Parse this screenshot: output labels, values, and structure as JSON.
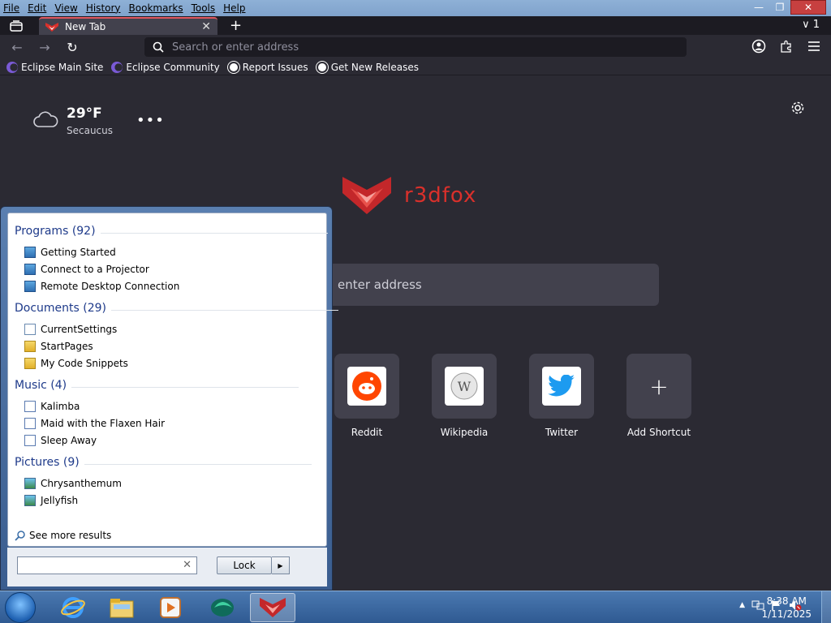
{
  "menu": [
    "File",
    "Edit",
    "View",
    "History",
    "Bookmarks",
    "Tools",
    "Help"
  ],
  "tab": {
    "title": "New Tab",
    "count": "1"
  },
  "urlbar": {
    "placeholder": "Search or enter address"
  },
  "bookmarks": [
    "Eclipse Main Site",
    "Eclipse Community",
    "Report Issues",
    "Get New Releases"
  ],
  "weather": {
    "temp": "29°F",
    "city": "Secaucus"
  },
  "brand": {
    "name": "r3dfox"
  },
  "content_search": {
    "placeholder_visible": "enter address"
  },
  "shortcuts": [
    {
      "label": "Reddit"
    },
    {
      "label": "Wikipedia"
    },
    {
      "label": "Twitter"
    },
    {
      "label": "Add Shortcut"
    }
  ],
  "start_menu": {
    "groups": [
      {
        "title": "Programs (92)",
        "items": [
          "Getting Started",
          "Connect to a Projector",
          "Remote Desktop Connection"
        ]
      },
      {
        "title": "Documents (29)",
        "items": [
          "CurrentSettings",
          "StartPages",
          "My Code Snippets"
        ]
      },
      {
        "title": "Music (4)",
        "items": [
          "Kalimba",
          "Maid with the Flaxen Hair",
          "Sleep Away"
        ]
      },
      {
        "title": "Pictures (9)",
        "items": [
          "Chrysanthemum",
          "Jellyfish"
        ]
      }
    ],
    "see_more": "See more results",
    "lock_label": "Lock"
  },
  "clock": {
    "time": "8:38 AM",
    "date": "1/11/2025"
  },
  "colors": {
    "accent": "#d9302b",
    "background": "#2b2a33",
    "tile": "#42414d"
  }
}
